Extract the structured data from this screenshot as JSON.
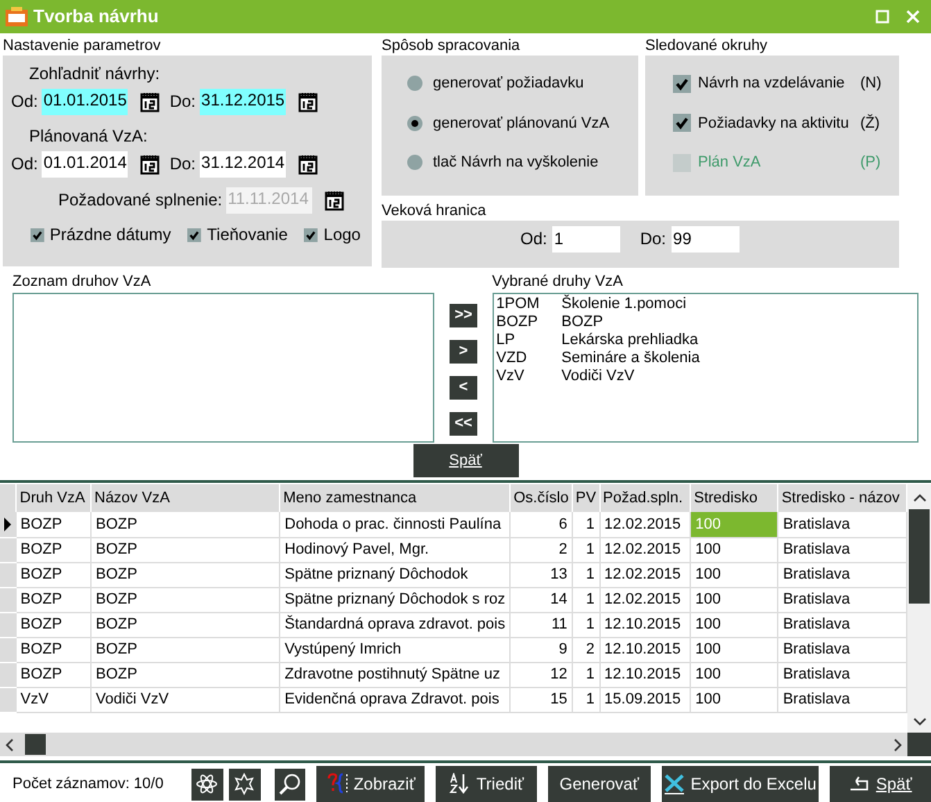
{
  "window": {
    "title": "Tvorba návrhu"
  },
  "parameters": {
    "title": "Nastavenie parametrov",
    "consider_label": "Zohľadniť návrhy:",
    "consider_from": {
      "label": "Od:",
      "value": "01.01.2015",
      "highlighted": true
    },
    "consider_to": {
      "label": "Do:",
      "value": "31.12.2015",
      "highlighted": true
    },
    "planned_label": "Plánovaná VzA:",
    "planned_from": {
      "label": "Od:",
      "value": "01.01.2014",
      "highlighted": false
    },
    "planned_to": {
      "label": "Do:",
      "value": "31.12.2014",
      "highlighted": false
    },
    "required": {
      "label": "Požadované splnenie:",
      "value": "11.11.2014",
      "disabled": true
    },
    "options": [
      {
        "label": "Prázdne dátumy",
        "checked": true
      },
      {
        "label": "Tieňovanie",
        "checked": true
      },
      {
        "label": "Logo",
        "checked": true
      }
    ]
  },
  "processing": {
    "title": "Spôsob spracovania",
    "options": [
      {
        "label": "generovať požiadavku",
        "selected": false
      },
      {
        "label": "generovať plánovanú VzA",
        "selected": true
      },
      {
        "label": "tlač Návrh na vyškolenie",
        "selected": false
      }
    ]
  },
  "areas": {
    "title": "Sledované okruhy",
    "items": [
      {
        "label": "Návrh na vzdelávanie",
        "code": "(N)",
        "checked": true,
        "disabled": false
      },
      {
        "label": "Požiadavky na aktivitu",
        "code": "(Ž)",
        "checked": true,
        "disabled": false
      },
      {
        "label": "Plán VzA",
        "code": "(P)",
        "checked": false,
        "disabled": true
      }
    ]
  },
  "age": {
    "title": "Veková hranica",
    "from_label": "Od:",
    "from": "1",
    "to_label": "Do:",
    "to": "99"
  },
  "available": {
    "title": "Zoznam druhov VzA"
  },
  "transfer_buttons": [
    ">>",
    ">",
    "<",
    "<<"
  ],
  "chosen": {
    "title": "Vybrané druhy VzA",
    "items": [
      {
        "code": "1POM",
        "name": "Školenie 1.pomoci"
      },
      {
        "code": "BOZP",
        "name": "BOZP"
      },
      {
        "code": "LP",
        "name": "Lekárska prehliadka"
      },
      {
        "code": "VZD",
        "name": "Semináre a školenia"
      },
      {
        "code": "VzV",
        "name": "Vodiči VzV"
      }
    ]
  },
  "back_button": "Späť",
  "table": {
    "columns": [
      "Druh VzA",
      "Názov VzA",
      "Meno zamestnanca",
      "Os.číslo",
      "PV",
      "Požad.spln.",
      "Stredisko",
      "Stredisko - názov"
    ],
    "rows": [
      {
        "selected": true,
        "cells": [
          "BOZP",
          "BOZP",
          "Dohoda o prac. činnosti Paulína",
          "6",
          "1",
          "12.02.2015",
          "100",
          "Bratislava"
        ]
      },
      {
        "selected": false,
        "cells": [
          "BOZP",
          "BOZP",
          "Hodinový  Pavel, Mgr.",
          "2",
          "1",
          "12.02.2015",
          "100",
          "Bratislava"
        ]
      },
      {
        "selected": false,
        "cells": [
          "BOZP",
          "BOZP",
          "Spätne priznaný Dôchodok",
          "13",
          "1",
          "12.02.2015",
          "100",
          "Bratislava"
        ]
      },
      {
        "selected": false,
        "cells": [
          "BOZP",
          "BOZP",
          "Spätne priznaný Dôchodok s roz",
          "14",
          "1",
          "12.02.2015",
          "100",
          "Bratislava"
        ]
      },
      {
        "selected": false,
        "cells": [
          "BOZP",
          "BOZP",
          "Štandardná oprava zdravot. pois",
          "11",
          "1",
          "12.10.2015",
          "100",
          "Bratislava"
        ]
      },
      {
        "selected": false,
        "cells": [
          "BOZP",
          "BOZP",
          "Vystúpený Imrich",
          "9",
          "2",
          "12.10.2015",
          "100",
          "Bratislava"
        ]
      },
      {
        "selected": false,
        "cells": [
          "BOZP",
          "BOZP",
          "Zdravotne postihnutý Spätne uz",
          "12",
          "1",
          "12.10.2015",
          "100",
          "Bratislava"
        ]
      },
      {
        "selected": false,
        "cells": [
          "VzV",
          "Vodiči VzV",
          "Evidenčná oprava Zdravot. pois",
          "15",
          "1",
          "15.09.2015",
          "100",
          "Bratislava"
        ]
      }
    ]
  },
  "status_bar": {
    "count": "Počet záznamov: 10/0",
    "buttons": [
      {
        "kind": "show",
        "label": "Zobraziť"
      },
      {
        "kind": "sort",
        "label": "Triediť"
      },
      {
        "kind": "plain",
        "label": "Generovať"
      },
      {
        "kind": "excel",
        "label": "Export do Excelu"
      },
      {
        "kind": "back",
        "label": "Späť"
      }
    ]
  }
}
